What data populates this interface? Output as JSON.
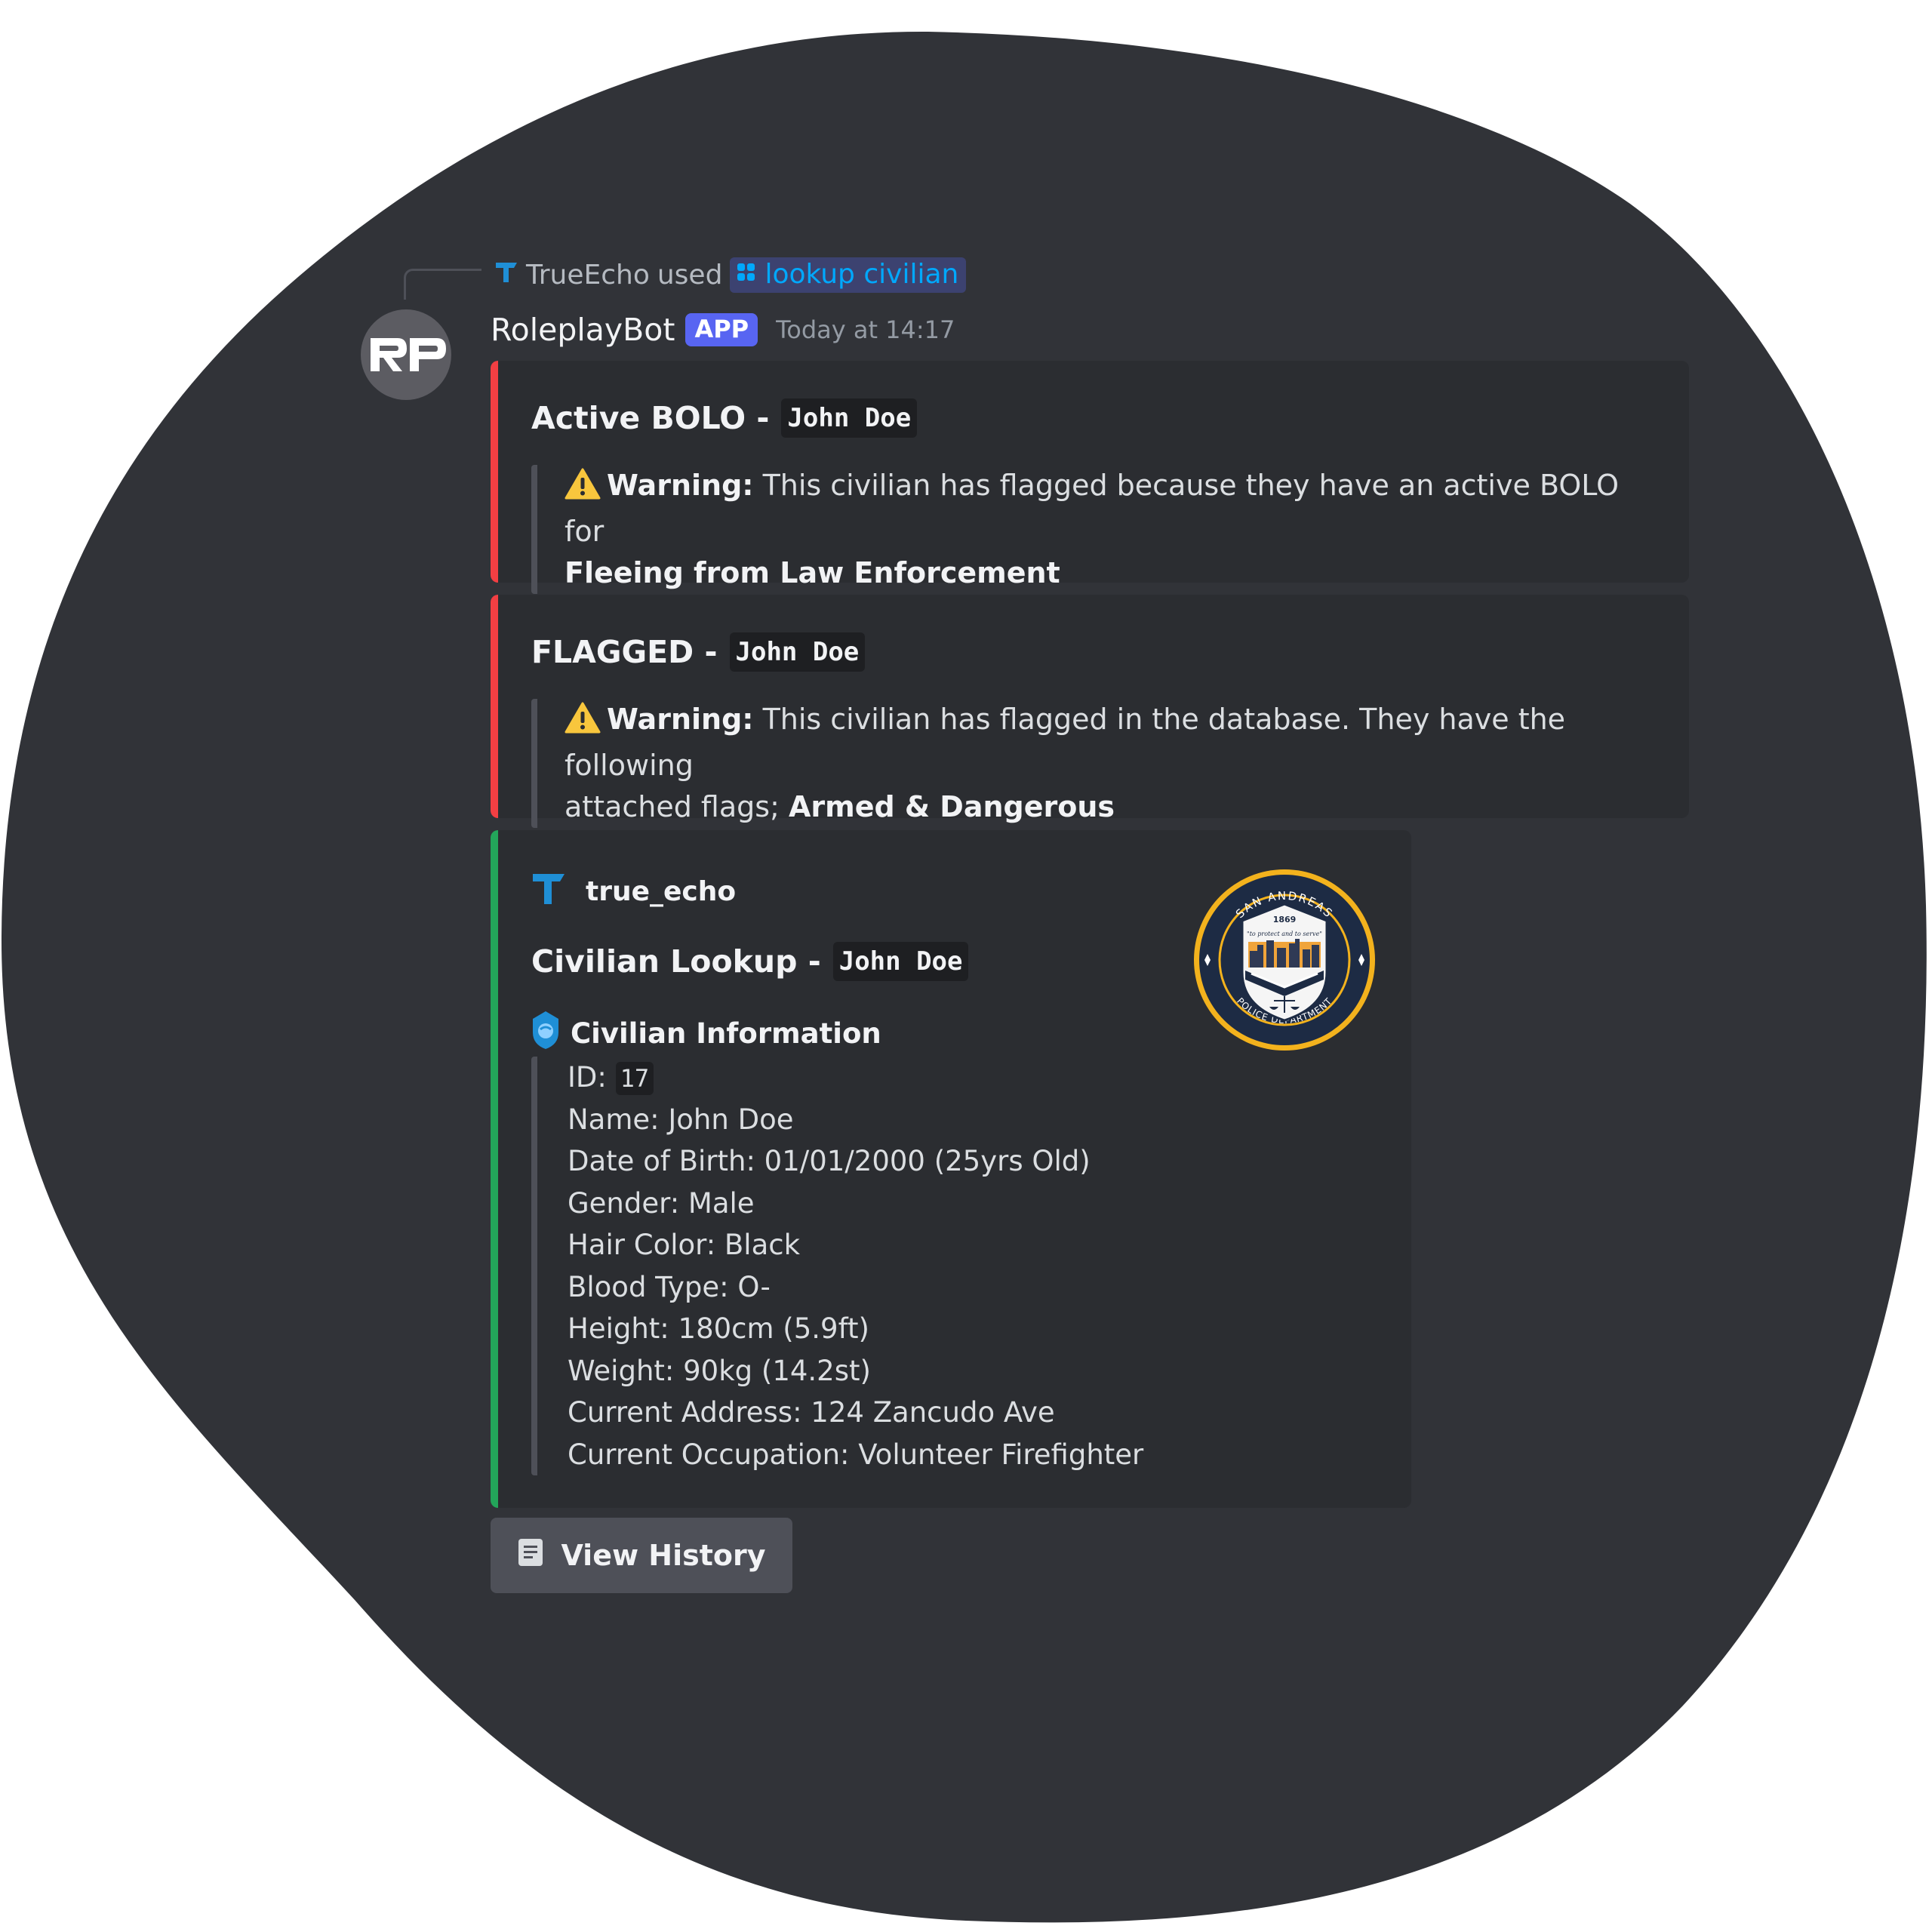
{
  "reply": {
    "user": "TrueEcho",
    "verb": "used",
    "command": "lookup civilian"
  },
  "message": {
    "author": "RoleplayBot",
    "badge": "APP",
    "timestamp": "Today at 14:17",
    "avatar_initials": "RP"
  },
  "embeds": [
    {
      "color": "#f23f43",
      "title_prefix": "Active BOLO -",
      "title_code": "John Doe",
      "warning_label": "Warning:",
      "warning_text": " This civilian has flagged because they have an active BOLO for",
      "warning_bold": "Fleeing from Law Enforcement"
    },
    {
      "color": "#f23f43",
      "title_prefix": "FLAGGED -",
      "title_code": "John Doe",
      "warning_label": "Warning:",
      "warning_text": " This civilian has flagged in the database. They have the following",
      "warning_text_2": "attached flags; ",
      "warning_bold": "Armed & Dangerous"
    },
    {
      "color": "#23a55a",
      "author": "true_echo",
      "title_prefix": "Civilian Lookup -",
      "title_code": "John Doe",
      "field_name": "Civilian Information",
      "id_label": "ID: ",
      "id_value": "17",
      "lines": [
        "Name: John Doe",
        "Date of Birth: 01/01/2000 (25yrs Old)",
        "Gender: Male",
        "Hair Color: Black",
        "Blood Type: O-",
        "Height: 180cm (5.9ft)",
        "Weight: 90kg (14.2st)",
        "Current Address: 124 Zancudo Ave",
        "Current Occupation: Volunteer Firefighter"
      ],
      "seal": {
        "top_text": "SAN ANDREAS",
        "year": "1869",
        "motto": "\"to protect and to serve\"",
        "bottom_text": "POLICE DEPARTMENT"
      }
    }
  ],
  "button": {
    "label": "View History",
    "icon": "document-icon"
  },
  "colors": {
    "background": "#313338",
    "embed": "#2b2d31",
    "red": "#f23f43",
    "green": "#23a55a",
    "blurple": "#5865f2",
    "link": "#00a8fc"
  }
}
